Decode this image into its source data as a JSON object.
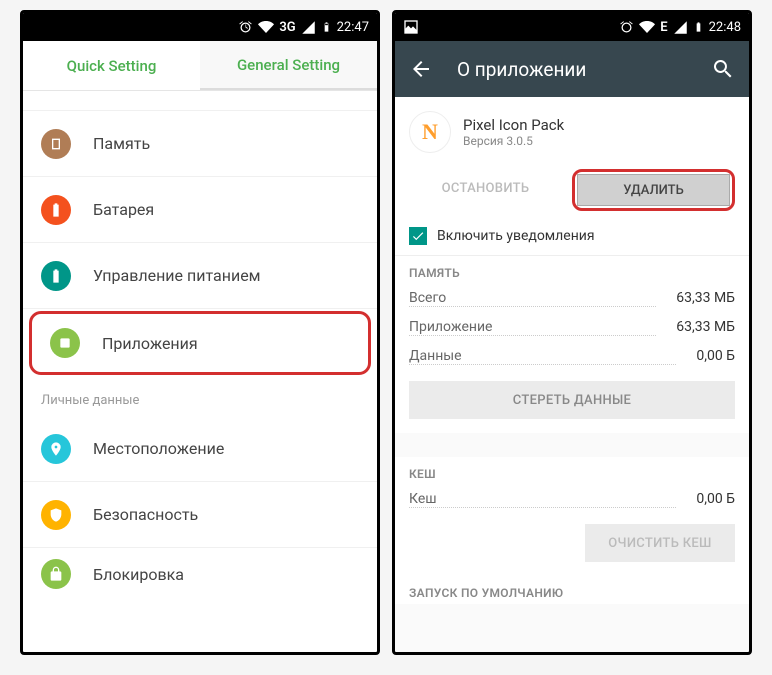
{
  "phone1": {
    "status": {
      "time": "22:47",
      "network": "3G"
    },
    "tabs": {
      "quick": "Quick Setting",
      "general": "General Setting"
    },
    "items": {
      "memory": "Память",
      "battery": "Батарея",
      "power": "Управление питанием",
      "apps": "Приложения",
      "location": "Местоположение",
      "security": "Безопасность",
      "lock": "Блокировка"
    },
    "section_personal": "Личные данные"
  },
  "phone2": {
    "status": {
      "time": "22:48",
      "network": "E"
    },
    "title": "О приложении",
    "app": {
      "name": "Pixel Icon Pack",
      "version": "Версия 3.0.5",
      "icon_letter": "N"
    },
    "buttons": {
      "stop": "ОСТАНОВИТЬ",
      "delete": "УДАЛИТЬ"
    },
    "notif": "Включить уведомления",
    "memory": {
      "title": "ПАМЯТЬ",
      "total_k": "Всего",
      "total_v": "63,33 МБ",
      "app_k": "Приложение",
      "app_v": "63,33 МБ",
      "data_k": "Данные",
      "data_v": "0,00 Б",
      "clear": "СТЕРЕТЬ ДАННЫЕ"
    },
    "cache": {
      "title": "КЕШ",
      "cache_k": "Кеш",
      "cache_v": "0,00 Б",
      "clear": "ОЧИСТИТЬ КЕШ"
    },
    "launch": {
      "title": "ЗАПУСК ПО УМОЛЧАНИЮ"
    }
  }
}
